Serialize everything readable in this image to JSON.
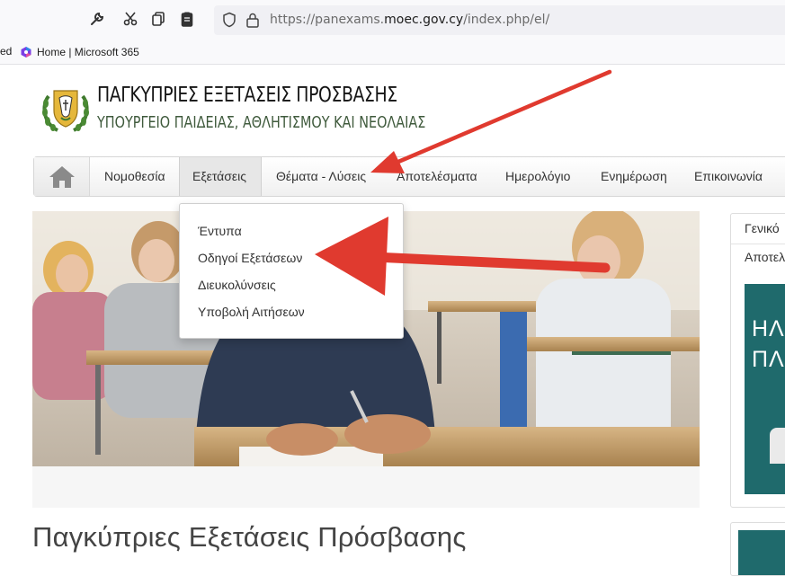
{
  "browser": {
    "url_prefix": "https://panexams.",
    "url_domain": "moec.gov.cy",
    "url_suffix": "/index.php/el/",
    "bookmarks_cut": "ed",
    "bookmark_label": "Home | Microsoft 365",
    "toolbar_icons": [
      "wrench-icon",
      "scissors-icon",
      "copy-icon",
      "clipboard-icon"
    ]
  },
  "site": {
    "title": "ΠΑΓΚΥΠΡΙΕΣ ΕΞΕΤΑΣΕΙΣ ΠΡΟΣΒΑΣΗΣ",
    "subtitle": "ΥΠΟΥΡΓΕΙΟ ΠΑΙΔΕΙΑΣ, ΑΘΛΗΤΙΣΜΟΥ ΚΑΙ ΝΕΟΛΑΙΑΣ"
  },
  "nav": {
    "items": [
      {
        "label": "Νομοθεσία"
      },
      {
        "label": "Εξετάσεις"
      },
      {
        "label": "Θέματα - Λύσεις"
      },
      {
        "label": "Αποτελέσματα"
      },
      {
        "label": "Ημερολόγιο"
      },
      {
        "label": "Ενημέρωση"
      },
      {
        "label": "Επικοινωνία"
      }
    ]
  },
  "dropdown": {
    "items": [
      {
        "label": "Έντυπα"
      },
      {
        "label": "Οδηγοί Εξετάσεων"
      },
      {
        "label": "Διευκολύνσεις"
      },
      {
        "label": "Υποβολή Αιτήσεων"
      }
    ]
  },
  "main": {
    "heading": "Παγκύπριες Εξετάσεις Πρόσβασης"
  },
  "sidebar": {
    "row1": "Γενικό",
    "row2": "Αποτελ",
    "banner_line1": "ΗΛ",
    "banner_line2": "ΠΛ"
  },
  "colors": {
    "annotation_arrow": "#e03a2f",
    "banner": "#1f6a6c"
  }
}
